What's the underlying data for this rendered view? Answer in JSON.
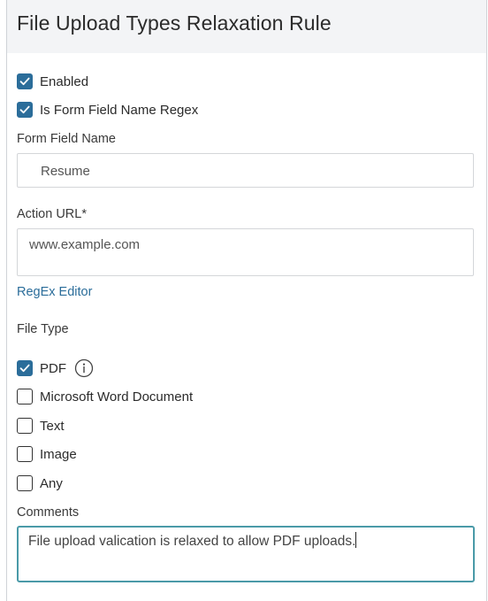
{
  "dialog": {
    "title": "File Upload Types Relaxation Rule"
  },
  "checkboxes": {
    "enabled": {
      "label": "Enabled",
      "checked": true
    },
    "is_regex": {
      "label": "Is Form Field Name Regex",
      "checked": true
    }
  },
  "form_field_name": {
    "label": "Form Field Name",
    "value": "Resume"
  },
  "action_url": {
    "label": "Action URL*",
    "value": "www.example.com"
  },
  "regex_editor": {
    "label": "RegEx Editor"
  },
  "file_type": {
    "label": "File Type",
    "options": [
      {
        "label": "PDF",
        "checked": true,
        "icon": "info-icon"
      },
      {
        "label": "Microsoft Word Document",
        "checked": false
      },
      {
        "label": "Text",
        "checked": false
      },
      {
        "label": "Image",
        "checked": false
      },
      {
        "label": "Any",
        "checked": false
      }
    ]
  },
  "comments": {
    "label": "Comments",
    "value": "File upload valication is relaxed to allow PDF uploads."
  },
  "colors": {
    "accent": "#2b6d9a",
    "focus_border": "#4a9aa8",
    "header_bg": "#f3f4f6"
  }
}
